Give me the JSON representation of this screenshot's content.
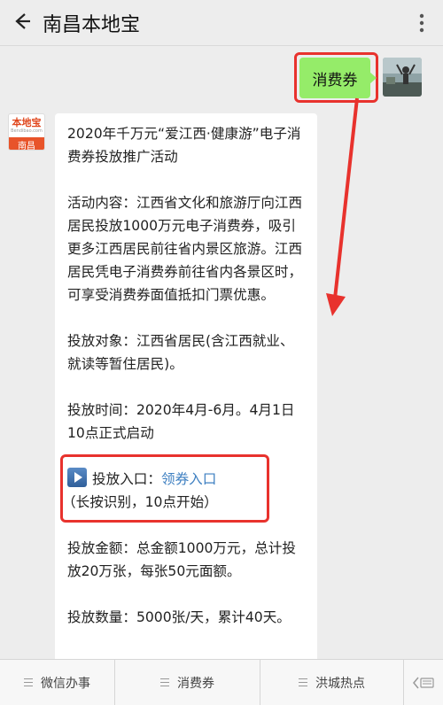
{
  "header": {
    "title": "南昌本地宝",
    "back_icon": "back-arrow-icon",
    "more_icon": "more-dots-icon"
  },
  "outgoing": {
    "text": "消费券"
  },
  "bot_avatar": {
    "brand": "本地宝",
    "sub": "Bendibao.com",
    "city": "南昌"
  },
  "message": {
    "title": "2020年千万元“爱江西·健康游”电子消费券投放推广活动",
    "content": "活动内容：江西省文化和旅游厅向江西居民投放1000万元电子消费券，吸引更多江西居民前往省内景区旅游。江西居民凭电子消费券前往省内各景区时，可享受消费券面值抵扣门票优惠。",
    "target": "投放对象：江西省居民(含江西就业、就读等暂住居民)。",
    "time": "投放时间：2020年4月-6月。4月1日10点正式启动",
    "entry_prefix": "投放入口：",
    "entry_link": "领券入口",
    "entry_note": "（长按识别，10点开始）",
    "amount": "投放金额：总金额1000万元，总计投放20万张，每张50元面额。",
    "quantity": "投放数量：5000张/天，累计40天。"
  },
  "footer": {
    "tabs": [
      "微信办事",
      "消费券",
      "洪城热点"
    ],
    "keyboard_icon": "keyboard-icon"
  },
  "colors": {
    "accent_red": "#e8322d",
    "bubble_green": "#95ec69",
    "link_blue": "#3d7fc1"
  }
}
